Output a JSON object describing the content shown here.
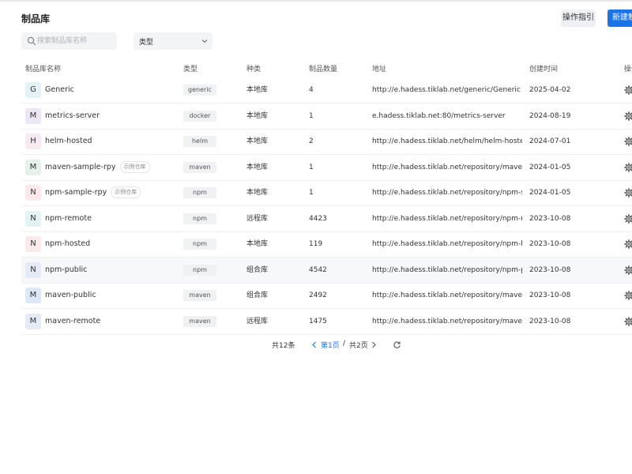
{
  "page": {
    "title": "制品库"
  },
  "toolbar": {
    "guide_label": "操作指引",
    "new_label": "新建制品库"
  },
  "filters": {
    "search_placeholder": "搜索制品库名称",
    "type_label": "类型"
  },
  "table": {
    "headers": [
      "制品库名称",
      "类型",
      "种类",
      "制品数量",
      "地址",
      "创建时间",
      "操作"
    ],
    "rows": [
      {
        "initial": "G",
        "name": "Generic",
        "tag": "",
        "type": "generic",
        "kind": "本地库",
        "count": "4",
        "address": "http://e.hadess.tiklab.net/generic/Generic",
        "created": "2025-04-02"
      },
      {
        "initial": "M",
        "name": "metrics-server",
        "tag": "",
        "type": "docker",
        "kind": "本地库",
        "count": "1",
        "address": "e.hadess.tiklab.net:80/metrics-server",
        "created": "2024-08-19"
      },
      {
        "initial": "H",
        "name": "helm-hosted",
        "tag": "",
        "type": "helm",
        "kind": "本地库",
        "count": "2",
        "address": "http://e.hadess.tiklab.net/helm/helm-hosted",
        "created": "2024-07-01"
      },
      {
        "initial": "M",
        "name": "maven-sample-rpy",
        "tag": "示例仓库",
        "type": "maven",
        "kind": "本地库",
        "count": "1",
        "address": "http://e.hadess.tiklab.net/repository/maven...",
        "created": "2024-01-05"
      },
      {
        "initial": "N",
        "name": "npm-sample-rpy",
        "tag": "示例仓库",
        "type": "npm",
        "kind": "本地库",
        "count": "1",
        "address": "http://e.hadess.tiklab.net/repository/npm-s...",
        "created": "2024-01-05"
      },
      {
        "initial": "N",
        "name": "npm-remote",
        "tag": "",
        "type": "npm",
        "kind": "远程库",
        "count": "4423",
        "address": "http://e.hadess.tiklab.net/repository/npm-r...",
        "created": "2023-10-08"
      },
      {
        "initial": "N",
        "name": "npm-hosted",
        "tag": "",
        "type": "npm",
        "kind": "本地库",
        "count": "119",
        "address": "http://e.hadess.tiklab.net/repository/npm-h...",
        "created": "2023-10-08"
      },
      {
        "initial": "N",
        "name": "npm-public",
        "tag": "",
        "type": "npm",
        "kind": "组合库",
        "count": "4542",
        "address": "http://e.hadess.tiklab.net/repository/npm-p...",
        "created": "2023-10-08"
      },
      {
        "initial": "M",
        "name": "maven-public",
        "tag": "",
        "type": "maven",
        "kind": "组合库",
        "count": "2492",
        "address": "http://e.hadess.tiklab.net/repository/maven...",
        "created": "2023-10-08"
      },
      {
        "initial": "M",
        "name": "maven-remote",
        "tag": "",
        "type": "maven",
        "kind": "远程库",
        "count": "1475",
        "address": "http://e.hadess.tiklab.net/repository/maven...",
        "created": "2023-10-08"
      }
    ]
  },
  "pagination": {
    "total": "共12条",
    "current_page": "第1页",
    "separator": "/",
    "total_pages": "共2页"
  },
  "colors": {
    "accent": "#1a73e8",
    "avatar_bg": [
      "#e3f2f4",
      "#ece6f6",
      "#f6e9f2",
      "#e6f1ec",
      "#fbe9ec",
      "#e3f2f2",
      "#fbeaec",
      "#e4ebf6",
      "#dde7f5",
      "#e6e9f6"
    ]
  },
  "icons": {
    "search": "search-icon",
    "select": "chevron-down-icon",
    "action": "gear-icon",
    "prev": "chevron-left-icon",
    "next": "chevron-right-icon",
    "refresh": "refresh-icon"
  }
}
